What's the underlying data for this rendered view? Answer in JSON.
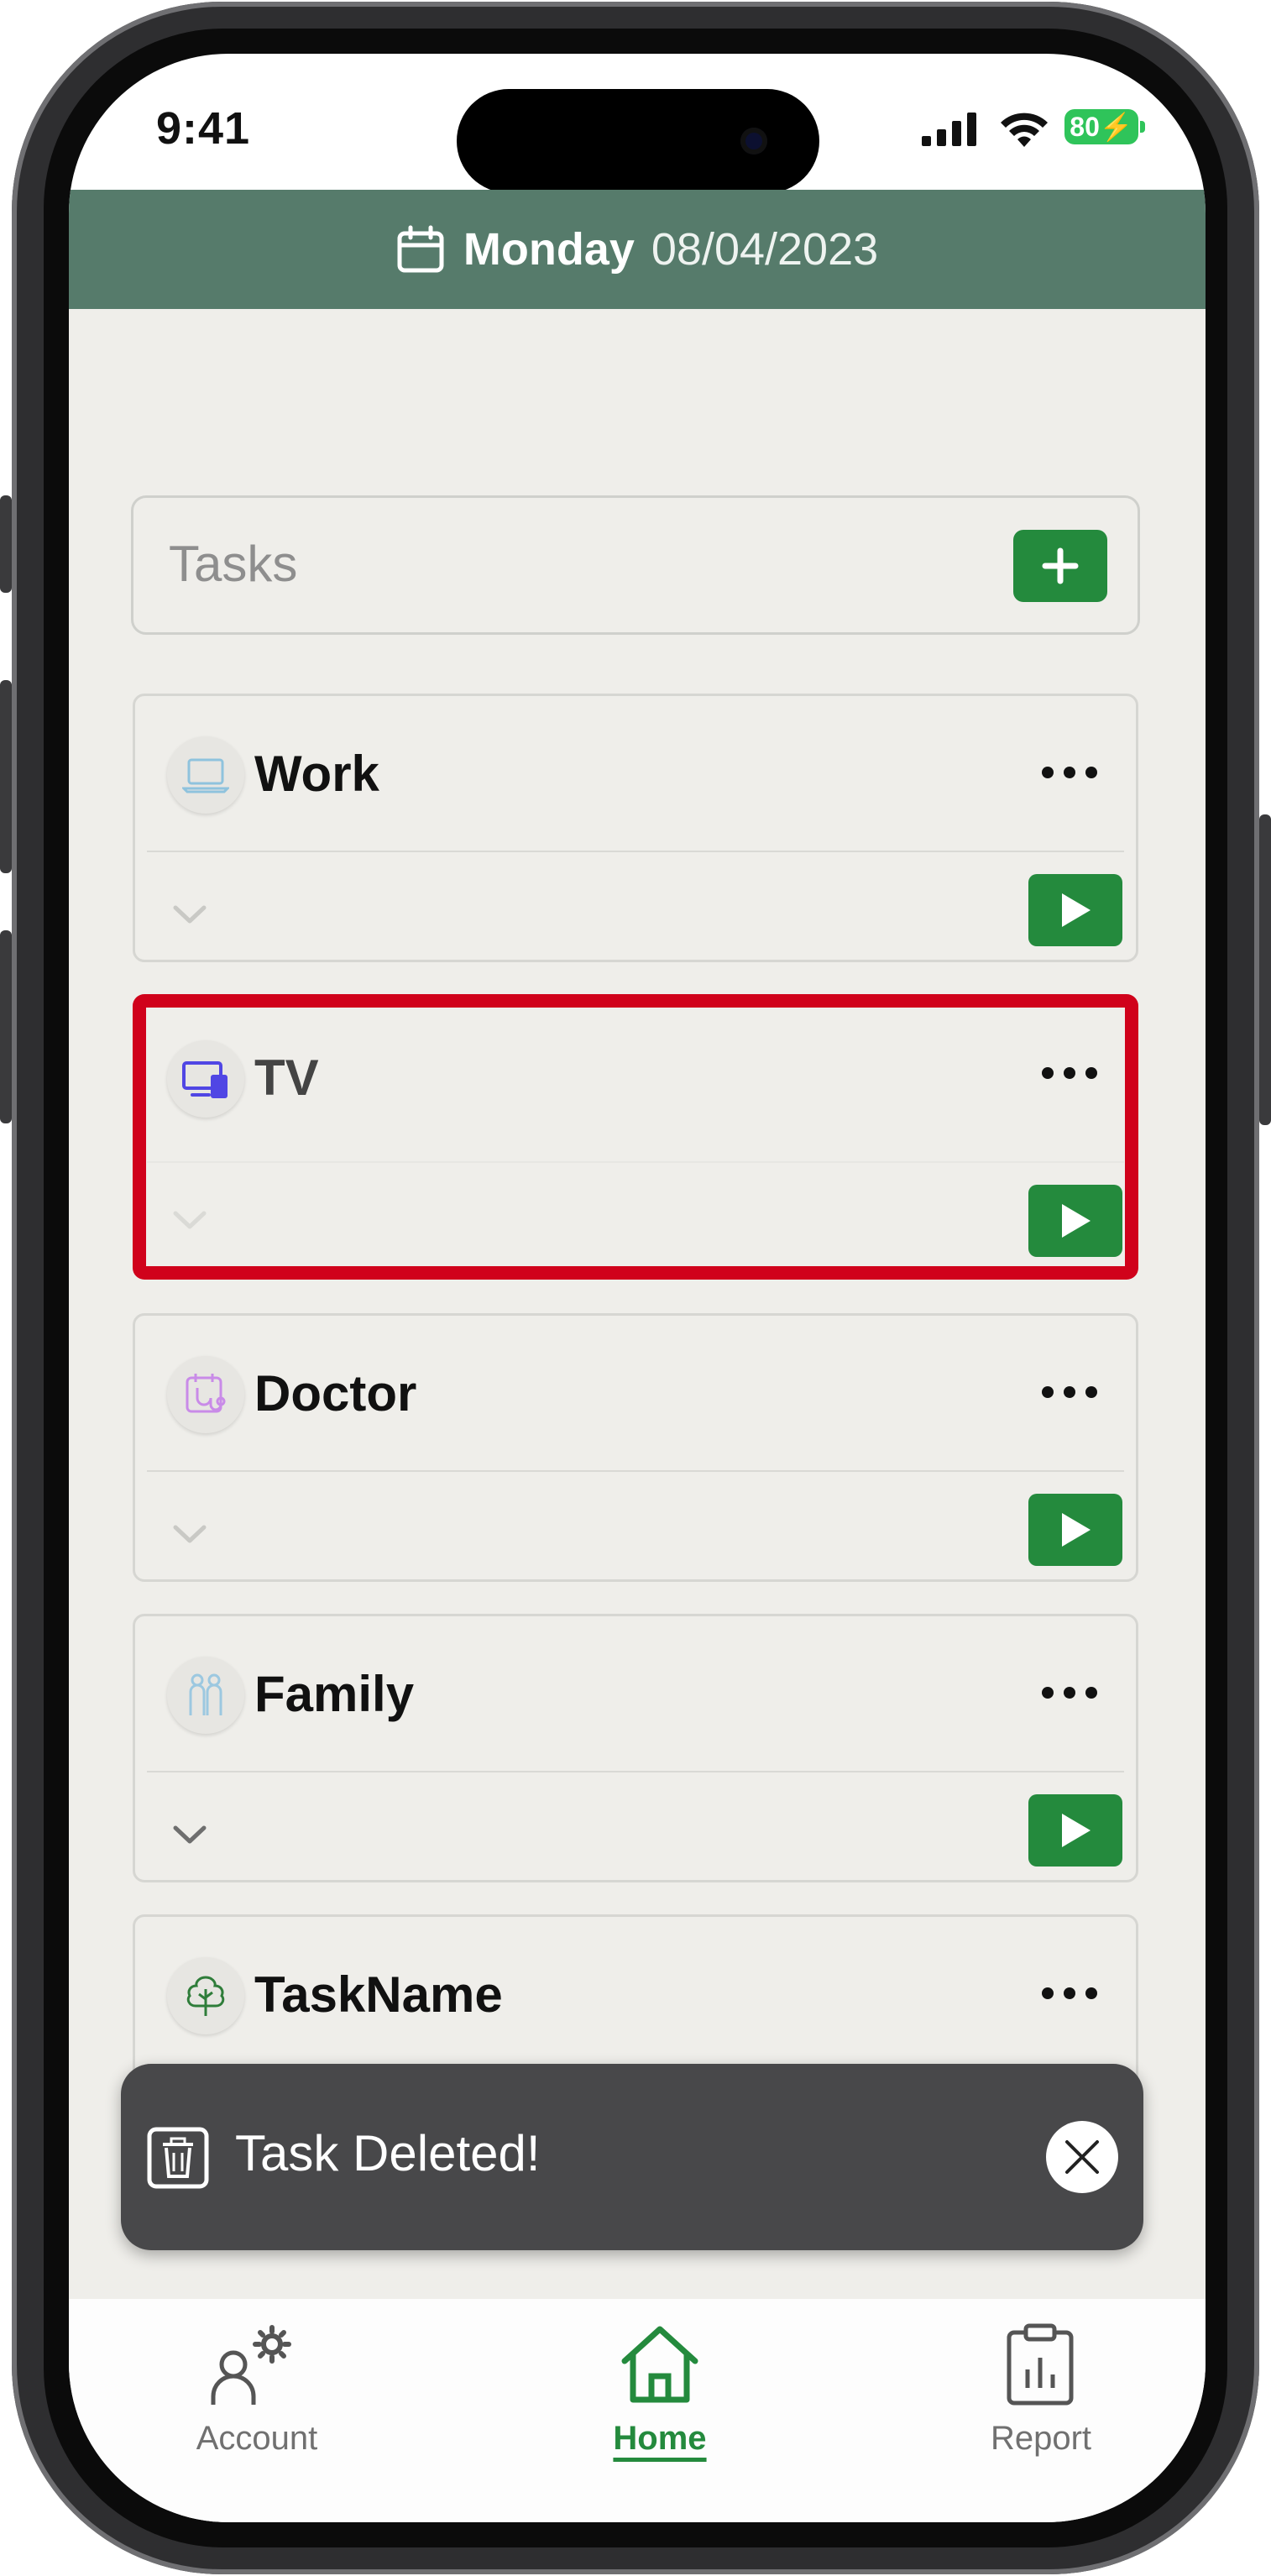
{
  "status_bar": {
    "time": "9:41",
    "battery": "80"
  },
  "header": {
    "day": "Monday",
    "date": "08/04/2023"
  },
  "tasks_bar": {
    "label": "Tasks"
  },
  "tasks": [
    {
      "name": "Work",
      "icon": "laptop-icon"
    },
    {
      "name": "TV",
      "icon": "devices-icon"
    },
    {
      "name": "Doctor",
      "icon": "medical-calendar-icon"
    },
    {
      "name": "Family",
      "icon": "family-icon"
    },
    {
      "name": "TaskName",
      "icon": "tree-icon"
    }
  ],
  "toast": {
    "message": "Task Deleted!"
  },
  "nav": {
    "account": "Account",
    "home": "Home",
    "report": "Report"
  },
  "colors": {
    "header": "#567b6b",
    "accent_green": "#248a3d",
    "highlight": "#d0021b",
    "toast_bg": "#48484a"
  }
}
